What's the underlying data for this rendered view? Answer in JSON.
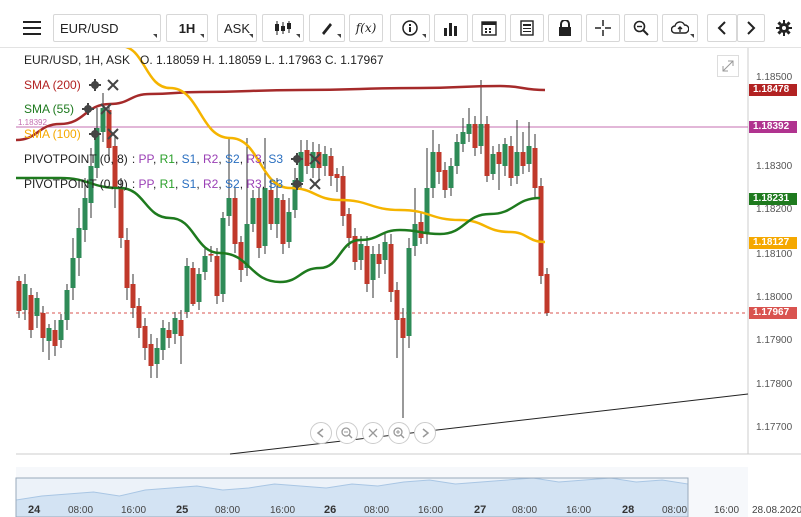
{
  "toolbar": {
    "symbol": "EUR/USD",
    "timeframe": "1H",
    "price_type": "ASK",
    "icons": [
      "menu-icon",
      "candles-icon",
      "draw-icon",
      "function-icon",
      "info-icon",
      "volume-bars-icon",
      "calendar-icon",
      "news-icon",
      "lock-icon",
      "crosshair-icon",
      "zoom-icon",
      "cloud-upload-icon",
      "prev-icon",
      "next-icon",
      "settings-icon"
    ]
  },
  "header": {
    "title": "EUR/USD, 1H, ASK",
    "ohlc": "O. 1.18059 H. 1.18059 L. 1.17963 C. 1.17967"
  },
  "indicators": [
    {
      "label": "SMA (200)",
      "color": "#b22222"
    },
    {
      "label": "SMA (55)",
      "color": "#1e7a1e"
    },
    {
      "label": "SMA (100)",
      "color": "#f5a800"
    }
  ],
  "pivot_rows": [
    {
      "label": "PIVOTPOINT (0, 8)",
      "levels": [
        "PP",
        "R1",
        "S1",
        "R2",
        "S2",
        "R3",
        "S3"
      ]
    },
    {
      "label": "PIVOTPOINT (0, 9)",
      "levels": [
        "PP",
        "R1",
        "S1",
        "R2",
        "S2",
        "R3",
        "S3"
      ]
    }
  ],
  "pivot_level_colors": [
    "#9a3fb5",
    "#2aa02a",
    "#2a6fc0",
    "#9a3fb5",
    "#2a6fc0",
    "#9a3fb5",
    "#2a6fc0"
  ],
  "hline_label": "1.18392",
  "price_badges": [
    {
      "value": "1.18478",
      "color": "#b22222"
    },
    {
      "value": "1.18392",
      "color": "#b0338f"
    },
    {
      "value": "1.18231",
      "color": "#1e7a1e"
    },
    {
      "value": "1.18127",
      "color": "#f5a800"
    },
    {
      "value": "1.17967",
      "color": "#d9534f"
    }
  ],
  "y_ticks": [
    "1.18500",
    "1.18400",
    "1.18300",
    "1.18200",
    "1.18100",
    "1.18000",
    "1.17900",
    "1.17800",
    "1.17700"
  ],
  "x_ticks": [
    {
      "label": "24",
      "day": true
    },
    {
      "label": "08:00"
    },
    {
      "label": "16:00"
    },
    {
      "label": "25",
      "day": true
    },
    {
      "label": "08:00"
    },
    {
      "label": "16:00"
    },
    {
      "label": "26",
      "day": true
    },
    {
      "label": "08:00"
    },
    {
      "label": "16:00"
    },
    {
      "label": "27",
      "day": true
    },
    {
      "label": "08:00"
    },
    {
      "label": "16:00"
    },
    {
      "label": "28",
      "day": true
    },
    {
      "label": "08:00"
    },
    {
      "label": "16:00"
    },
    {
      "label": "28.08.2020"
    }
  ],
  "nav_buttons": [
    "scroll-left-icon",
    "zoom-out-icon",
    "fit-icon",
    "zoom-in-icon",
    "scroll-right-icon"
  ],
  "colors": {
    "up": "#2e8b57",
    "down": "#c0392b",
    "bg": "#ffffff"
  }
}
